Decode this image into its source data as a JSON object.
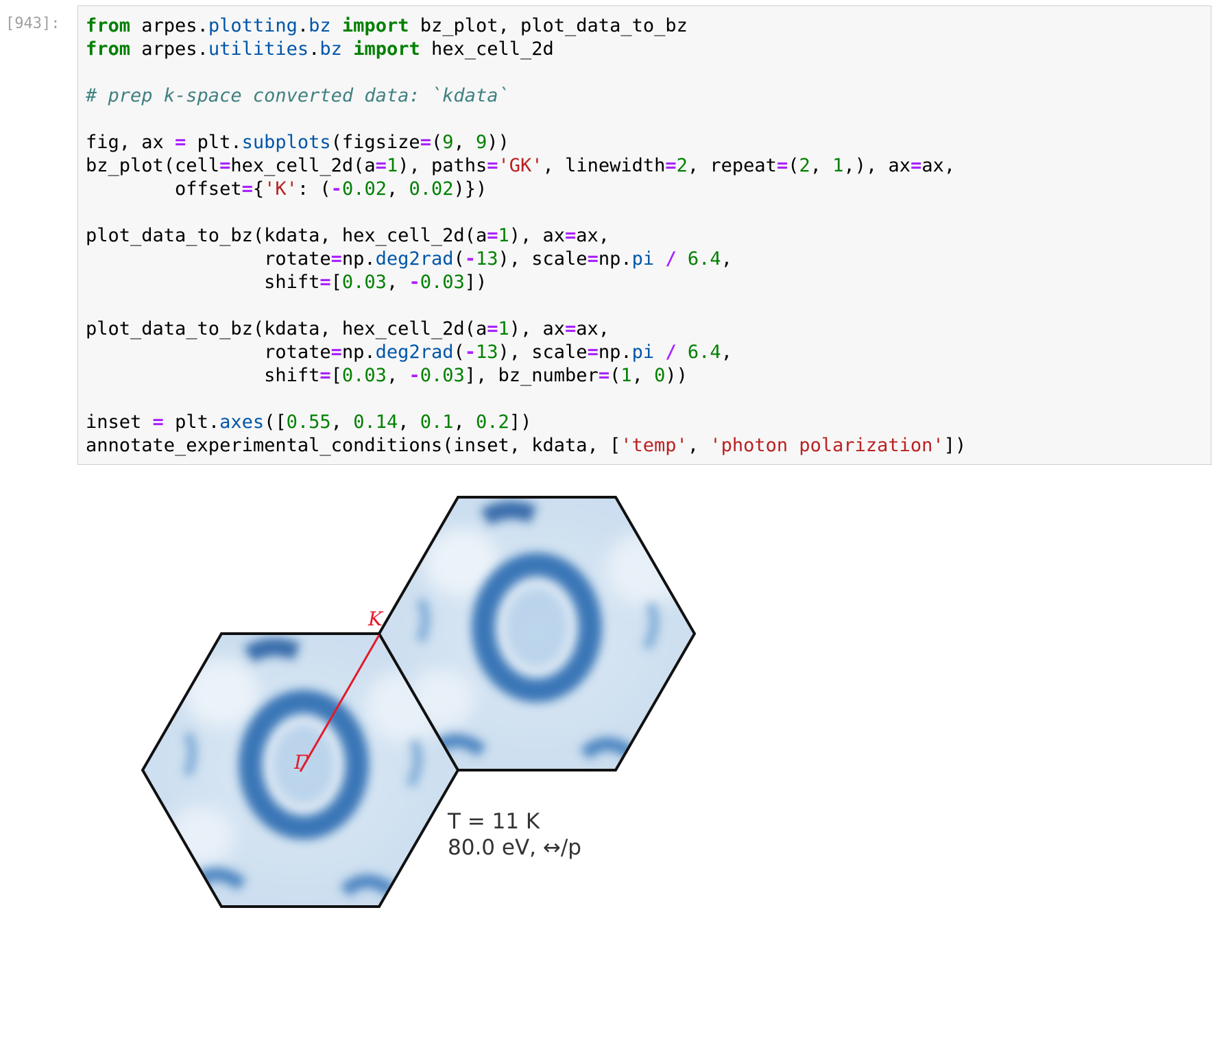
{
  "cell": {
    "prompt": "[943]:",
    "code_lines": [
      [
        {
          "t": "from",
          "c": "kw"
        },
        {
          "t": " arpes."
        },
        {
          "t": "plotting",
          "c": "at"
        },
        {
          "t": "."
        },
        {
          "t": "bz",
          "c": "at"
        },
        {
          "t": " "
        },
        {
          "t": "import",
          "c": "kw"
        },
        {
          "t": " bz_plot, plot_data_to_bz"
        }
      ],
      [
        {
          "t": "from",
          "c": "kw"
        },
        {
          "t": " arpes."
        },
        {
          "t": "utilities",
          "c": "at"
        },
        {
          "t": "."
        },
        {
          "t": "bz",
          "c": "at"
        },
        {
          "t": " "
        },
        {
          "t": "import",
          "c": "kw"
        },
        {
          "t": " hex_cell_2d"
        }
      ],
      [],
      [
        {
          "t": "# prep k-space converted data: `kdata`",
          "c": "cm"
        }
      ],
      [],
      [
        {
          "t": "fig, ax "
        },
        {
          "t": "=",
          "c": "op"
        },
        {
          "t": " plt."
        },
        {
          "t": "subplots",
          "c": "at"
        },
        {
          "t": "(figsize"
        },
        {
          "t": "=",
          "c": "op"
        },
        {
          "t": "("
        },
        {
          "t": "9",
          "c": "num"
        },
        {
          "t": ", "
        },
        {
          "t": "9",
          "c": "num"
        },
        {
          "t": "))"
        }
      ],
      [
        {
          "t": "bz_plot(cell"
        },
        {
          "t": "=",
          "c": "op"
        },
        {
          "t": "hex_cell_2d(a"
        },
        {
          "t": "=",
          "c": "op"
        },
        {
          "t": "1",
          "c": "num"
        },
        {
          "t": "), paths"
        },
        {
          "t": "=",
          "c": "op"
        },
        {
          "t": "'GK'",
          "c": "str"
        },
        {
          "t": ", linewidth"
        },
        {
          "t": "=",
          "c": "op"
        },
        {
          "t": "2",
          "c": "num"
        },
        {
          "t": ", repeat"
        },
        {
          "t": "=",
          "c": "op"
        },
        {
          "t": "("
        },
        {
          "t": "2",
          "c": "num"
        },
        {
          "t": ", "
        },
        {
          "t": "1",
          "c": "num"
        },
        {
          "t": ",), ax"
        },
        {
          "t": "=",
          "c": "op"
        },
        {
          "t": "ax,"
        }
      ],
      [
        {
          "t": "        offset"
        },
        {
          "t": "=",
          "c": "op"
        },
        {
          "t": "{"
        },
        {
          "t": "'K'",
          "c": "str"
        },
        {
          "t": ": ("
        },
        {
          "t": "-",
          "c": "op"
        },
        {
          "t": "0.02",
          "c": "num"
        },
        {
          "t": ", "
        },
        {
          "t": "0.02",
          "c": "num"
        },
        {
          "t": ")})"
        }
      ],
      [],
      [
        {
          "t": "plot_data_to_bz(kdata, hex_cell_2d(a"
        },
        {
          "t": "=",
          "c": "op"
        },
        {
          "t": "1",
          "c": "num"
        },
        {
          "t": "), ax"
        },
        {
          "t": "=",
          "c": "op"
        },
        {
          "t": "ax,"
        }
      ],
      [
        {
          "t": "                rotate"
        },
        {
          "t": "=",
          "c": "op"
        },
        {
          "t": "np."
        },
        {
          "t": "deg2rad",
          "c": "at"
        },
        {
          "t": "("
        },
        {
          "t": "-",
          "c": "op"
        },
        {
          "t": "13",
          "c": "num"
        },
        {
          "t": "), scale"
        },
        {
          "t": "=",
          "c": "op"
        },
        {
          "t": "np."
        },
        {
          "t": "pi",
          "c": "at"
        },
        {
          "t": " "
        },
        {
          "t": "/",
          "c": "op"
        },
        {
          "t": " "
        },
        {
          "t": "6.4",
          "c": "num"
        },
        {
          "t": ","
        }
      ],
      [
        {
          "t": "                shift"
        },
        {
          "t": "=",
          "c": "op"
        },
        {
          "t": "["
        },
        {
          "t": "0.03",
          "c": "num"
        },
        {
          "t": ", "
        },
        {
          "t": "-",
          "c": "op"
        },
        {
          "t": "0.03",
          "c": "num"
        },
        {
          "t": "])"
        }
      ],
      [],
      [
        {
          "t": "plot_data_to_bz(kdata, hex_cell_2d(a"
        },
        {
          "t": "=",
          "c": "op"
        },
        {
          "t": "1",
          "c": "num"
        },
        {
          "t": "), ax"
        },
        {
          "t": "=",
          "c": "op"
        },
        {
          "t": "ax,"
        }
      ],
      [
        {
          "t": "                rotate"
        },
        {
          "t": "=",
          "c": "op"
        },
        {
          "t": "np."
        },
        {
          "t": "deg2rad",
          "c": "at"
        },
        {
          "t": "("
        },
        {
          "t": "-",
          "c": "op"
        },
        {
          "t": "13",
          "c": "num"
        },
        {
          "t": "), scale"
        },
        {
          "t": "=",
          "c": "op"
        },
        {
          "t": "np."
        },
        {
          "t": "pi",
          "c": "at"
        },
        {
          "t": " "
        },
        {
          "t": "/",
          "c": "op"
        },
        {
          "t": " "
        },
        {
          "t": "6.4",
          "c": "num"
        },
        {
          "t": ","
        }
      ],
      [
        {
          "t": "                shift"
        },
        {
          "t": "=",
          "c": "op"
        },
        {
          "t": "["
        },
        {
          "t": "0.03",
          "c": "num"
        },
        {
          "t": ", "
        },
        {
          "t": "-",
          "c": "op"
        },
        {
          "t": "0.03",
          "c": "num"
        },
        {
          "t": "], bz_number"
        },
        {
          "t": "=",
          "c": "op"
        },
        {
          "t": "("
        },
        {
          "t": "1",
          "c": "num"
        },
        {
          "t": ", "
        },
        {
          "t": "0",
          "c": "num"
        },
        {
          "t": "))"
        }
      ],
      [],
      [
        {
          "t": "inset "
        },
        {
          "t": "=",
          "c": "op"
        },
        {
          "t": " plt."
        },
        {
          "t": "axes",
          "c": "at"
        },
        {
          "t": "(["
        },
        {
          "t": "0.55",
          "c": "num"
        },
        {
          "t": ", "
        },
        {
          "t": "0.14",
          "c": "num"
        },
        {
          "t": ", "
        },
        {
          "t": "0.1",
          "c": "num"
        },
        {
          "t": ", "
        },
        {
          "t": "0.2",
          "c": "num"
        },
        {
          "t": "])"
        }
      ],
      [
        {
          "t": "annotate_experimental_conditions(inset, kdata, ["
        },
        {
          "t": "'temp'",
          "c": "str"
        },
        {
          "t": ", "
        },
        {
          "t": "'photon polarization'",
          "c": "str"
        },
        {
          "t": "])"
        }
      ]
    ]
  },
  "figure": {
    "colors": {
      "outline": "#111111",
      "path": "#e31a2a",
      "fill_light": "#d8e6f3",
      "fill_mid": "#7fb0da",
      "fill_dark": "#1c5fa8"
    },
    "gamma_label": "Γ",
    "k_label": "K",
    "annotation_line1": "T = 11 K",
    "annotation_line2": "80.0 eV, ↔/p"
  }
}
